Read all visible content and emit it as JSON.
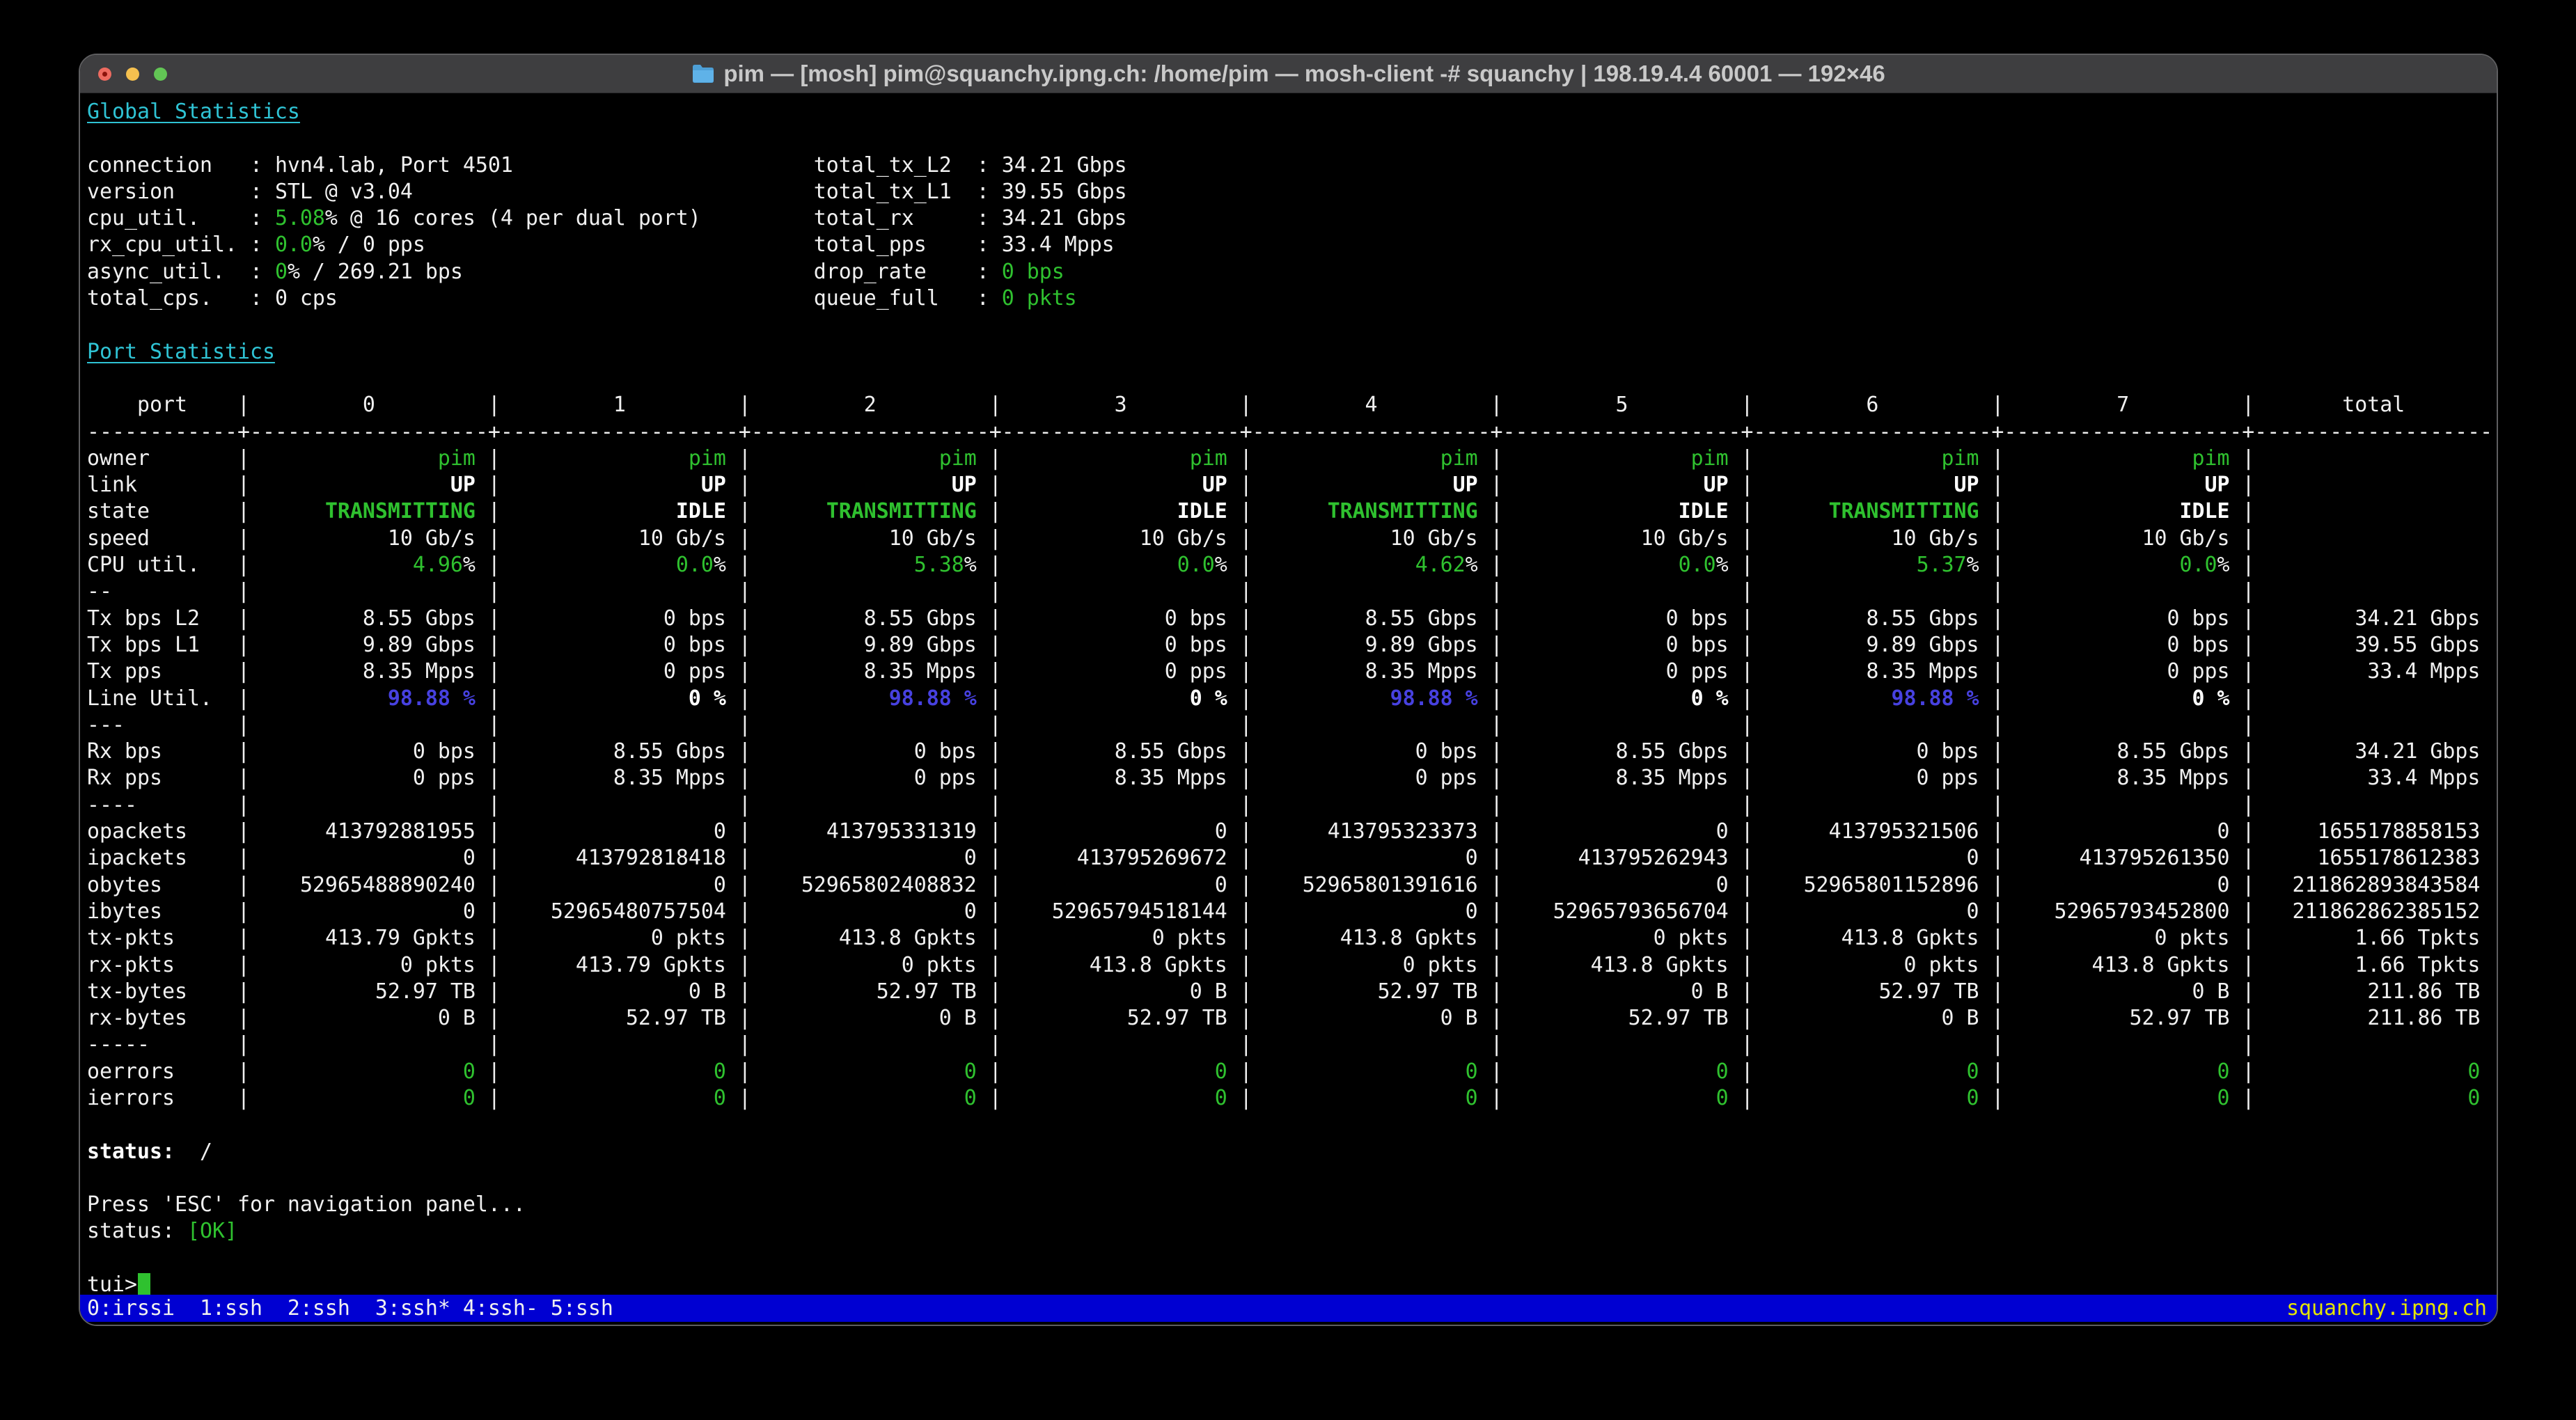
{
  "window": {
    "title": "pim — [mosh] pim@squanchy.ipng.ch: /home/pim — mosh-client -# squanchy | 198.19.4.4 60001 — 192×46",
    "buttons": {
      "close": "close",
      "minimize": "minimize",
      "zoom": "zoom"
    }
  },
  "colors": {
    "green": "#2fc12f",
    "cyan": "#2fc3d4",
    "blue": "#4741e0",
    "yellow": "#e5e500",
    "tmux_bg": "#0000d2",
    "text": "#f0f0f0"
  },
  "global": {
    "heading": "Global Statistics",
    "rows": [
      {
        "left": {
          "label": "connection",
          "segs": [
            [
              "hvn4.lab, Port 4501",
              "w"
            ]
          ]
        },
        "right": {
          "label": "total_tx_L2",
          "segs": [
            [
              "34.21 Gbps",
              "w"
            ]
          ]
        }
      },
      {
        "left": {
          "label": "version",
          "segs": [
            [
              "STL @ v3.04",
              "w"
            ]
          ]
        },
        "right": {
          "label": "total_tx_L1",
          "segs": [
            [
              "39.55 Gbps",
              "w"
            ]
          ]
        }
      },
      {
        "left": {
          "label": "cpu_util.",
          "segs": [
            [
              "5.08",
              "g"
            ],
            [
              "% @ 16 cores (4 per dual port)",
              "w"
            ]
          ]
        },
        "right": {
          "label": "total_rx",
          "segs": [
            [
              "34.21 Gbps",
              "w"
            ]
          ]
        }
      },
      {
        "left": {
          "label": "rx_cpu_util.",
          "segs": [
            [
              "0.0",
              "g"
            ],
            [
              "% / 0 pps",
              "w"
            ]
          ]
        },
        "right": {
          "label": "total_pps",
          "segs": [
            [
              "33.4 Mpps",
              "w"
            ]
          ]
        }
      },
      {
        "left": {
          "label": "async_util.",
          "segs": [
            [
              "0",
              "g"
            ],
            [
              "% / 269.21 bps",
              "w"
            ]
          ]
        },
        "right": {
          "label": "drop_rate",
          "segs": [
            [
              "0 bps",
              "g"
            ]
          ]
        }
      },
      {
        "left": {
          "label": "total_cps.",
          "segs": [
            [
              "0 cps",
              "w"
            ]
          ]
        },
        "right": {
          "label": "queue_full",
          "segs": [
            [
              "0 pkts",
              "g"
            ]
          ]
        }
      }
    ]
  },
  "table": {
    "heading": "Port Statistics",
    "label_header": "port",
    "columns": [
      "0",
      "1",
      "2",
      "3",
      "4",
      "5",
      "6",
      "7",
      "total"
    ],
    "rows": [
      {
        "label": "owner",
        "cells": [
          [
            "pim",
            "g"
          ],
          [
            "pim",
            "g"
          ],
          [
            "pim",
            "g"
          ],
          [
            "pim",
            "g"
          ],
          [
            "pim",
            "g"
          ],
          [
            "pim",
            "g"
          ],
          [
            "pim",
            "g"
          ],
          [
            "pim",
            "g"
          ],
          [
            "",
            ""
          ]
        ]
      },
      {
        "label": "link",
        "cells": [
          [
            "UP",
            "wb"
          ],
          [
            "UP",
            "wb"
          ],
          [
            "UP",
            "wb"
          ],
          [
            "UP",
            "wb"
          ],
          [
            "UP",
            "wb"
          ],
          [
            "UP",
            "wb"
          ],
          [
            "UP",
            "wb"
          ],
          [
            "UP",
            "wb"
          ],
          [
            "",
            ""
          ]
        ]
      },
      {
        "label": "state",
        "cells": [
          [
            "TRANSMITTING",
            "gb"
          ],
          [
            "IDLE",
            "wb"
          ],
          [
            "TRANSMITTING",
            "gb"
          ],
          [
            "IDLE",
            "wb"
          ],
          [
            "TRANSMITTING",
            "gb"
          ],
          [
            "IDLE",
            "wb"
          ],
          [
            "TRANSMITTING",
            "gb"
          ],
          [
            "IDLE",
            "wb"
          ],
          [
            "",
            ""
          ]
        ]
      },
      {
        "label": "speed",
        "cells": [
          [
            "10 Gb/s",
            "w"
          ],
          [
            "10 Gb/s",
            "w"
          ],
          [
            "10 Gb/s",
            "w"
          ],
          [
            "10 Gb/s",
            "w"
          ],
          [
            "10 Gb/s",
            "w"
          ],
          [
            "10 Gb/s",
            "w"
          ],
          [
            "10 Gb/s",
            "w"
          ],
          [
            "10 Gb/s",
            "w"
          ],
          [
            "",
            ""
          ]
        ]
      },
      {
        "label": "CPU util.",
        "cells": [
          [
            "4.96%",
            "pg"
          ],
          [
            "0.0%",
            "pg"
          ],
          [
            "5.38%",
            "pg"
          ],
          [
            "0.0%",
            "pg"
          ],
          [
            "4.62%",
            "pg"
          ],
          [
            "0.0%",
            "pg"
          ],
          [
            "5.37%",
            "pg"
          ],
          [
            "0.0%",
            "pg"
          ],
          [
            "",
            ""
          ]
        ]
      },
      {
        "label": "--",
        "cells": [
          [
            "",
            ""
          ],
          [
            "",
            ""
          ],
          [
            "",
            ""
          ],
          [
            "",
            ""
          ],
          [
            "",
            ""
          ],
          [
            "",
            ""
          ],
          [
            "",
            ""
          ],
          [
            "",
            ""
          ],
          [
            "",
            ""
          ]
        ]
      },
      {
        "label": "Tx bps L2",
        "cells": [
          [
            "8.55 Gbps",
            "w"
          ],
          [
            "0 bps",
            "w"
          ],
          [
            "8.55 Gbps",
            "w"
          ],
          [
            "0 bps",
            "w"
          ],
          [
            "8.55 Gbps",
            "w"
          ],
          [
            "0 bps",
            "w"
          ],
          [
            "8.55 Gbps",
            "w"
          ],
          [
            "0 bps",
            "w"
          ],
          [
            "34.21 Gbps",
            "w"
          ]
        ]
      },
      {
        "label": "Tx bps L1",
        "cells": [
          [
            "9.89 Gbps",
            "w"
          ],
          [
            "0 bps",
            "w"
          ],
          [
            "9.89 Gbps",
            "w"
          ],
          [
            "0 bps",
            "w"
          ],
          [
            "9.89 Gbps",
            "w"
          ],
          [
            "0 bps",
            "w"
          ],
          [
            "9.89 Gbps",
            "w"
          ],
          [
            "0 bps",
            "w"
          ],
          [
            "39.55 Gbps",
            "w"
          ]
        ]
      },
      {
        "label": "Tx pps",
        "cells": [
          [
            "8.35 Mpps",
            "w"
          ],
          [
            "0 pps",
            "w"
          ],
          [
            "8.35 Mpps",
            "w"
          ],
          [
            "0 pps",
            "w"
          ],
          [
            "8.35 Mpps",
            "w"
          ],
          [
            "0 pps",
            "w"
          ],
          [
            "8.35 Mpps",
            "w"
          ],
          [
            "0 pps",
            "w"
          ],
          [
            "33.4 Mpps",
            "w"
          ]
        ]
      },
      {
        "label": "Line Util.",
        "cells": [
          [
            "98.88 %",
            "bb"
          ],
          [
            "0 %",
            "wb"
          ],
          [
            "98.88 %",
            "bb"
          ],
          [
            "0 %",
            "wb"
          ],
          [
            "98.88 %",
            "bb"
          ],
          [
            "0 %",
            "wb"
          ],
          [
            "98.88 %",
            "bb"
          ],
          [
            "0 %",
            "wb"
          ],
          [
            "",
            ""
          ]
        ]
      },
      {
        "label": "---",
        "cells": [
          [
            "",
            ""
          ],
          [
            "",
            ""
          ],
          [
            "",
            ""
          ],
          [
            "",
            ""
          ],
          [
            "",
            ""
          ],
          [
            "",
            ""
          ],
          [
            "",
            ""
          ],
          [
            "",
            ""
          ],
          [
            "",
            ""
          ]
        ]
      },
      {
        "label": "Rx bps",
        "cells": [
          [
            "0 bps",
            "w"
          ],
          [
            "8.55 Gbps",
            "w"
          ],
          [
            "0 bps",
            "w"
          ],
          [
            "8.55 Gbps",
            "w"
          ],
          [
            "0 bps",
            "w"
          ],
          [
            "8.55 Gbps",
            "w"
          ],
          [
            "0 bps",
            "w"
          ],
          [
            "8.55 Gbps",
            "w"
          ],
          [
            "34.21 Gbps",
            "w"
          ]
        ]
      },
      {
        "label": "Rx pps",
        "cells": [
          [
            "0 pps",
            "w"
          ],
          [
            "8.35 Mpps",
            "w"
          ],
          [
            "0 pps",
            "w"
          ],
          [
            "8.35 Mpps",
            "w"
          ],
          [
            "0 pps",
            "w"
          ],
          [
            "8.35 Mpps",
            "w"
          ],
          [
            "0 pps",
            "w"
          ],
          [
            "8.35 Mpps",
            "w"
          ],
          [
            "33.4 Mpps",
            "w"
          ]
        ]
      },
      {
        "label": "----",
        "cells": [
          [
            "",
            ""
          ],
          [
            "",
            ""
          ],
          [
            "",
            ""
          ],
          [
            "",
            ""
          ],
          [
            "",
            ""
          ],
          [
            "",
            ""
          ],
          [
            "",
            ""
          ],
          [
            "",
            ""
          ],
          [
            "",
            ""
          ]
        ]
      },
      {
        "label": "opackets",
        "cells": [
          [
            "413792881955",
            "w"
          ],
          [
            "0",
            "w"
          ],
          [
            "413795331319",
            "w"
          ],
          [
            "0",
            "w"
          ],
          [
            "413795323373",
            "w"
          ],
          [
            "0",
            "w"
          ],
          [
            "413795321506",
            "w"
          ],
          [
            "0",
            "w"
          ],
          [
            "1655178858153",
            "w"
          ]
        ]
      },
      {
        "label": "ipackets",
        "cells": [
          [
            "0",
            "w"
          ],
          [
            "413792818418",
            "w"
          ],
          [
            "0",
            "w"
          ],
          [
            "413795269672",
            "w"
          ],
          [
            "0",
            "w"
          ],
          [
            "413795262943",
            "w"
          ],
          [
            "0",
            "w"
          ],
          [
            "413795261350",
            "w"
          ],
          [
            "1655178612383",
            "w"
          ]
        ]
      },
      {
        "label": "obytes",
        "cells": [
          [
            "52965488890240",
            "w"
          ],
          [
            "0",
            "w"
          ],
          [
            "52965802408832",
            "w"
          ],
          [
            "0",
            "w"
          ],
          [
            "52965801391616",
            "w"
          ],
          [
            "0",
            "w"
          ],
          [
            "52965801152896",
            "w"
          ],
          [
            "0",
            "w"
          ],
          [
            "211862893843584",
            "w"
          ]
        ]
      },
      {
        "label": "ibytes",
        "cells": [
          [
            "0",
            "w"
          ],
          [
            "52965480757504",
            "w"
          ],
          [
            "0",
            "w"
          ],
          [
            "52965794518144",
            "w"
          ],
          [
            "0",
            "w"
          ],
          [
            "52965793656704",
            "w"
          ],
          [
            "0",
            "w"
          ],
          [
            "52965793452800",
            "w"
          ],
          [
            "211862862385152",
            "w"
          ]
        ]
      },
      {
        "label": "tx-pkts",
        "cells": [
          [
            "413.79 Gpkts",
            "w"
          ],
          [
            "0 pkts",
            "w"
          ],
          [
            "413.8 Gpkts",
            "w"
          ],
          [
            "0 pkts",
            "w"
          ],
          [
            "413.8 Gpkts",
            "w"
          ],
          [
            "0 pkts",
            "w"
          ],
          [
            "413.8 Gpkts",
            "w"
          ],
          [
            "0 pkts",
            "w"
          ],
          [
            "1.66 Tpkts",
            "w"
          ]
        ]
      },
      {
        "label": "rx-pkts",
        "cells": [
          [
            "0 pkts",
            "w"
          ],
          [
            "413.79 Gpkts",
            "w"
          ],
          [
            "0 pkts",
            "w"
          ],
          [
            "413.8 Gpkts",
            "w"
          ],
          [
            "0 pkts",
            "w"
          ],
          [
            "413.8 Gpkts",
            "w"
          ],
          [
            "0 pkts",
            "w"
          ],
          [
            "413.8 Gpkts",
            "w"
          ],
          [
            "1.66 Tpkts",
            "w"
          ]
        ]
      },
      {
        "label": "tx-bytes",
        "cells": [
          [
            "52.97 TB",
            "w"
          ],
          [
            "0 B",
            "w"
          ],
          [
            "52.97 TB",
            "w"
          ],
          [
            "0 B",
            "w"
          ],
          [
            "52.97 TB",
            "w"
          ],
          [
            "0 B",
            "w"
          ],
          [
            "52.97 TB",
            "w"
          ],
          [
            "0 B",
            "w"
          ],
          [
            "211.86 TB",
            "w"
          ]
        ]
      },
      {
        "label": "rx-bytes",
        "cells": [
          [
            "0 B",
            "w"
          ],
          [
            "52.97 TB",
            "w"
          ],
          [
            "0 B",
            "w"
          ],
          [
            "52.97 TB",
            "w"
          ],
          [
            "0 B",
            "w"
          ],
          [
            "52.97 TB",
            "w"
          ],
          [
            "0 B",
            "w"
          ],
          [
            "52.97 TB",
            "w"
          ],
          [
            "211.86 TB",
            "w"
          ]
        ]
      },
      {
        "label": "-----",
        "cells": [
          [
            "",
            ""
          ],
          [
            "",
            ""
          ],
          [
            "",
            ""
          ],
          [
            "",
            ""
          ],
          [
            "",
            ""
          ],
          [
            "",
            ""
          ],
          [
            "",
            ""
          ],
          [
            "",
            ""
          ],
          [
            "",
            ""
          ]
        ]
      },
      {
        "label": "oerrors",
        "cells": [
          [
            "0",
            "g"
          ],
          [
            "0",
            "g"
          ],
          [
            "0",
            "g"
          ],
          [
            "0",
            "g"
          ],
          [
            "0",
            "g"
          ],
          [
            "0",
            "g"
          ],
          [
            "0",
            "g"
          ],
          [
            "0",
            "g"
          ],
          [
            "0",
            "g"
          ]
        ]
      },
      {
        "label": "ierrors",
        "cells": [
          [
            "0",
            "g"
          ],
          [
            "0",
            "g"
          ],
          [
            "0",
            "g"
          ],
          [
            "0",
            "g"
          ],
          [
            "0",
            "g"
          ],
          [
            "0",
            "g"
          ],
          [
            "0",
            "g"
          ],
          [
            "0",
            "g"
          ],
          [
            "0",
            "g"
          ]
        ]
      }
    ]
  },
  "footer": {
    "spinner_label": "status:",
    "spinner": "/",
    "esc_hint": "Press 'ESC' for navigation panel...",
    "status_label": "status:",
    "status_value": "[OK]",
    "prompt": "tui>"
  },
  "tmux": {
    "left": "0:irssi  1:ssh  2:ssh  3:ssh* 4:ssh- 5:ssh",
    "right": "squanchy.ipng.ch"
  }
}
